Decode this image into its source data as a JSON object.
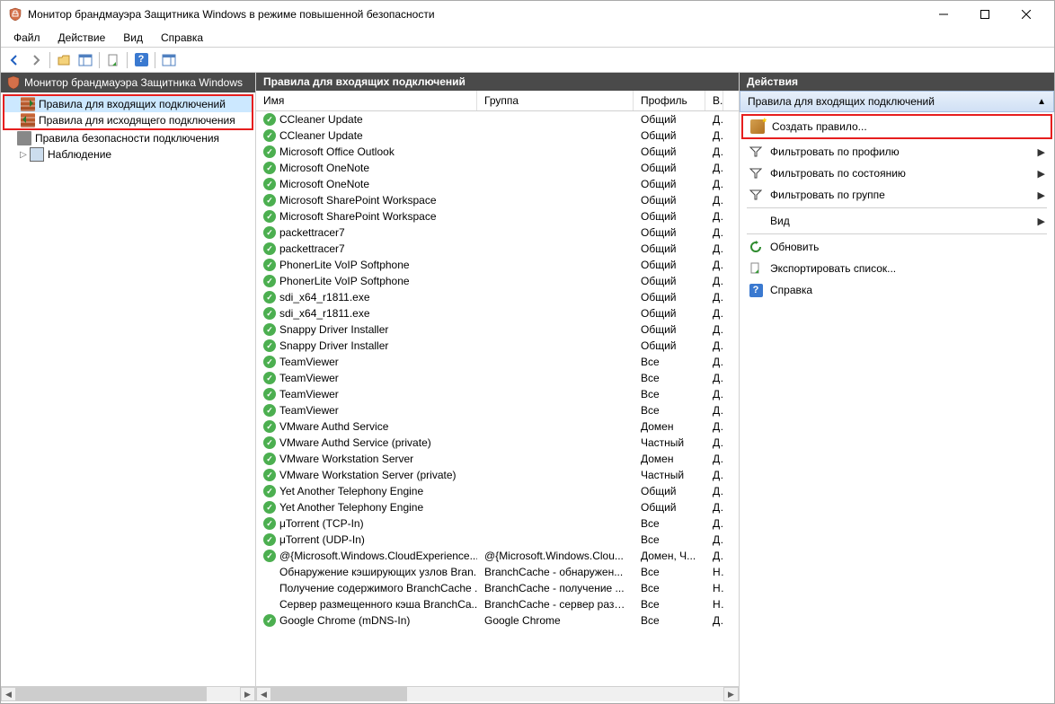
{
  "window": {
    "title": "Монитор брандмауэра Защитника Windows в режиме повышенной безопасности"
  },
  "menu": {
    "file": "Файл",
    "action": "Действие",
    "view": "Вид",
    "help": "Справка"
  },
  "tree": {
    "root": "Монитор брандмауэра Защитника Windows",
    "inbound": "Правила для входящих подключений",
    "outbound": "Правила для исходящего подключения",
    "security": "Правила безопасности подключения",
    "monitoring": "Наблюдение"
  },
  "rules": {
    "title": "Правила для входящих подключений",
    "columns": {
      "name": "Имя",
      "group": "Группа",
      "profile": "Профиль",
      "last": "В..."
    },
    "items": [
      {
        "icon": "check",
        "name": "CCleaner Update",
        "group": "",
        "profile": "Общий",
        "last": "Д..."
      },
      {
        "icon": "check",
        "name": "CCleaner Update",
        "group": "",
        "profile": "Общий",
        "last": "Д..."
      },
      {
        "icon": "check",
        "name": "Microsoft Office Outlook",
        "group": "",
        "profile": "Общий",
        "last": "Д..."
      },
      {
        "icon": "check",
        "name": "Microsoft OneNote",
        "group": "",
        "profile": "Общий",
        "last": "Д..."
      },
      {
        "icon": "check",
        "name": "Microsoft OneNote",
        "group": "",
        "profile": "Общий",
        "last": "Д..."
      },
      {
        "icon": "check",
        "name": "Microsoft SharePoint Workspace",
        "group": "",
        "profile": "Общий",
        "last": "Д..."
      },
      {
        "icon": "check",
        "name": "Microsoft SharePoint Workspace",
        "group": "",
        "profile": "Общий",
        "last": "Д..."
      },
      {
        "icon": "check",
        "name": "packettracer7",
        "group": "",
        "profile": "Общий",
        "last": "Д..."
      },
      {
        "icon": "check",
        "name": "packettracer7",
        "group": "",
        "profile": "Общий",
        "last": "Д..."
      },
      {
        "icon": "check",
        "name": "PhonerLite VoIP Softphone",
        "group": "",
        "profile": "Общий",
        "last": "Д..."
      },
      {
        "icon": "check",
        "name": "PhonerLite VoIP Softphone",
        "group": "",
        "profile": "Общий",
        "last": "Д..."
      },
      {
        "icon": "check",
        "name": "sdi_x64_r1811.exe",
        "group": "",
        "profile": "Общий",
        "last": "Д..."
      },
      {
        "icon": "check",
        "name": "sdi_x64_r1811.exe",
        "group": "",
        "profile": "Общий",
        "last": "Д..."
      },
      {
        "icon": "check",
        "name": "Snappy Driver Installer",
        "group": "",
        "profile": "Общий",
        "last": "Д..."
      },
      {
        "icon": "check",
        "name": "Snappy Driver Installer",
        "group": "",
        "profile": "Общий",
        "last": "Д..."
      },
      {
        "icon": "check",
        "name": "TeamViewer",
        "group": "",
        "profile": "Все",
        "last": "Д..."
      },
      {
        "icon": "check",
        "name": "TeamViewer",
        "group": "",
        "profile": "Все",
        "last": "Д..."
      },
      {
        "icon": "check",
        "name": "TeamViewer",
        "group": "",
        "profile": "Все",
        "last": "Д..."
      },
      {
        "icon": "check",
        "name": "TeamViewer",
        "group": "",
        "profile": "Все",
        "last": "Д..."
      },
      {
        "icon": "check",
        "name": "VMware Authd Service",
        "group": "",
        "profile": "Домен",
        "last": "Д..."
      },
      {
        "icon": "check",
        "name": "VMware Authd Service (private)",
        "group": "",
        "profile": "Частный",
        "last": "Д..."
      },
      {
        "icon": "check",
        "name": "VMware Workstation Server",
        "group": "",
        "profile": "Домен",
        "last": "Д..."
      },
      {
        "icon": "check",
        "name": "VMware Workstation Server (private)",
        "group": "",
        "profile": "Частный",
        "last": "Д..."
      },
      {
        "icon": "check",
        "name": "Yet Another Telephony Engine",
        "group": "",
        "profile": "Общий",
        "last": "Д..."
      },
      {
        "icon": "check",
        "name": "Yet Another Telephony Engine",
        "group": "",
        "profile": "Общий",
        "last": "Д..."
      },
      {
        "icon": "check",
        "name": "μTorrent (TCP-In)",
        "group": "",
        "profile": "Все",
        "last": "Д..."
      },
      {
        "icon": "check",
        "name": "μTorrent (UDP-In)",
        "group": "",
        "profile": "Все",
        "last": "Д..."
      },
      {
        "icon": "check",
        "name": "@{Microsoft.Windows.CloudExperience...",
        "group": "@{Microsoft.Windows.Clou...",
        "profile": "Домен, Ч...",
        "last": "Д..."
      },
      {
        "icon": "none",
        "name": "Обнаружение кэширующих узлов Bran...",
        "group": "BranchCache - обнаружен...",
        "profile": "Все",
        "last": "Н..."
      },
      {
        "icon": "none",
        "name": "Получение содержимого BranchCache ...",
        "group": "BranchCache - получение ...",
        "profile": "Все",
        "last": "Н..."
      },
      {
        "icon": "none",
        "name": "Сервер размещенного кэша BranchCa...",
        "group": "BranchCache - сервер разм...",
        "profile": "Все",
        "last": "Н..."
      },
      {
        "icon": "check",
        "name": "Google Chrome (mDNS-In)",
        "group": "Google Chrome",
        "profile": "Все",
        "last": "Д..."
      }
    ]
  },
  "actions": {
    "title": "Действия",
    "subheader": "Правила для входящих подключений",
    "new_rule": "Создать правило...",
    "filter_profile": "Фильтровать по профилю",
    "filter_state": "Фильтровать по состоянию",
    "filter_group": "Фильтровать по группе",
    "view": "Вид",
    "refresh": "Обновить",
    "export": "Экспортировать список...",
    "help": "Справка"
  }
}
